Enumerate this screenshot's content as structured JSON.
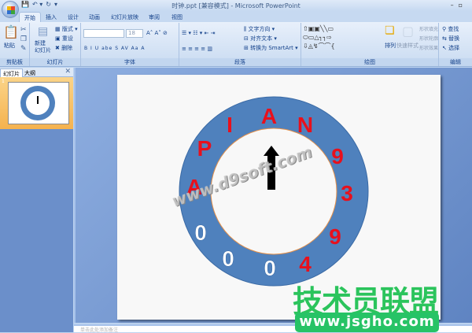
{
  "window": {
    "title": "时钟.ppt [兼容模式] - Microsoft PowerPoint",
    "controls": [
      "–",
      "▫"
    ]
  },
  "qat": [
    "💾",
    "↶ ▾",
    "↻",
    "▾"
  ],
  "tabs": [
    "开始",
    "插入",
    "设计",
    "动画",
    "幻灯片放映",
    "审阅",
    "视图"
  ],
  "ribbon": {
    "clipboard": {
      "label": "剪贴板",
      "paste": "粘贴"
    },
    "slides": {
      "label": "幻灯片",
      "new_slide": "新建\n幻灯片",
      "layout": "版式",
      "reset": "重设",
      "delete": "删除"
    },
    "font": {
      "label": "字体",
      "size": "18",
      "buttons": [
        "B",
        "I",
        "U",
        "abe",
        "S",
        "AV",
        "Aa",
        "A"
      ]
    },
    "paragraph": {
      "label": "段落",
      "text_direction": "文字方向",
      "align_text": "对齐文本",
      "smartart": "转换为 SmartArt"
    },
    "drawing": {
      "label": "绘图",
      "arrange": "排列",
      "quick_styles": "快速样式",
      "fill": "形状填充",
      "outline": "形状轮廓",
      "effects": "形状效果"
    },
    "editing": {
      "label": "编辑",
      "find": "查找",
      "replace": "替换",
      "select": "选择"
    }
  },
  "left_panel": {
    "tabs": [
      "幻灯片",
      "大纲"
    ],
    "slide_number": "1"
  },
  "slide": {
    "letters": [
      {
        "t": "A",
        "c": "red"
      },
      {
        "t": "N",
        "c": "red"
      },
      {
        "t": "9",
        "c": "red"
      },
      {
        "t": "3",
        "c": "red"
      },
      {
        "t": "9",
        "c": "red"
      },
      {
        "t": "4",
        "c": "red"
      },
      {
        "t": "0",
        "c": "white"
      },
      {
        "t": "0",
        "c": "white"
      },
      {
        "t": "0",
        "c": "white"
      },
      {
        "t": "A",
        "c": "red"
      },
      {
        "t": "P",
        "c": "red"
      },
      {
        "t": "I",
        "c": "red"
      }
    ],
    "ring_color": "#4f81bd",
    "letter_red": "#e8101c"
  },
  "watermark": "www.d9soft.com",
  "logo": {
    "cn": "技术员联盟",
    "url": "www.jsgho.com"
  },
  "notes_placeholder": "单击此处添加备注"
}
